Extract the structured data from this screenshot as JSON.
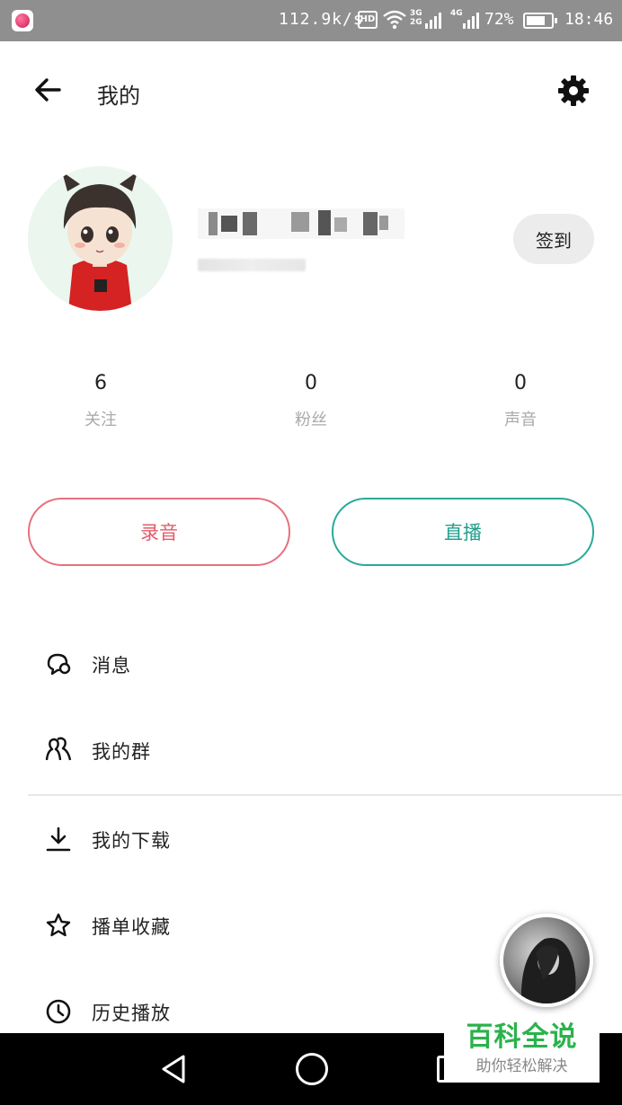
{
  "status_bar": {
    "network_speed": "112.9k/s",
    "hd_label": "HD",
    "network_type_1": "3G",
    "network_type_2": "2G",
    "network_type_3": "4G",
    "battery_percent": "72%",
    "time": "18:46"
  },
  "header": {
    "title": "我的",
    "back_icon": "arrow-left-icon",
    "settings_icon": "gear-icon"
  },
  "profile": {
    "checkin_label": "签到"
  },
  "stats": [
    {
      "value": "6",
      "label": "关注"
    },
    {
      "value": "0",
      "label": "粉丝"
    },
    {
      "value": "0",
      "label": "声音"
    }
  ],
  "actions": {
    "record_label": "录音",
    "live_label": "直播",
    "record_color": "#e25c6a",
    "live_color": "#229e8c"
  },
  "menu": [
    {
      "label": "消息",
      "icon": "chat-bubble-icon"
    },
    {
      "label": "我的群",
      "icon": "group-icon"
    },
    {
      "label": "我的下载",
      "icon": "download-icon"
    },
    {
      "label": "播单收藏",
      "icon": "star-icon"
    },
    {
      "label": "历史播放",
      "icon": "clock-icon"
    }
  ],
  "watermark": {
    "title": "百科全说",
    "subtitle": "助你轻松解决"
  }
}
